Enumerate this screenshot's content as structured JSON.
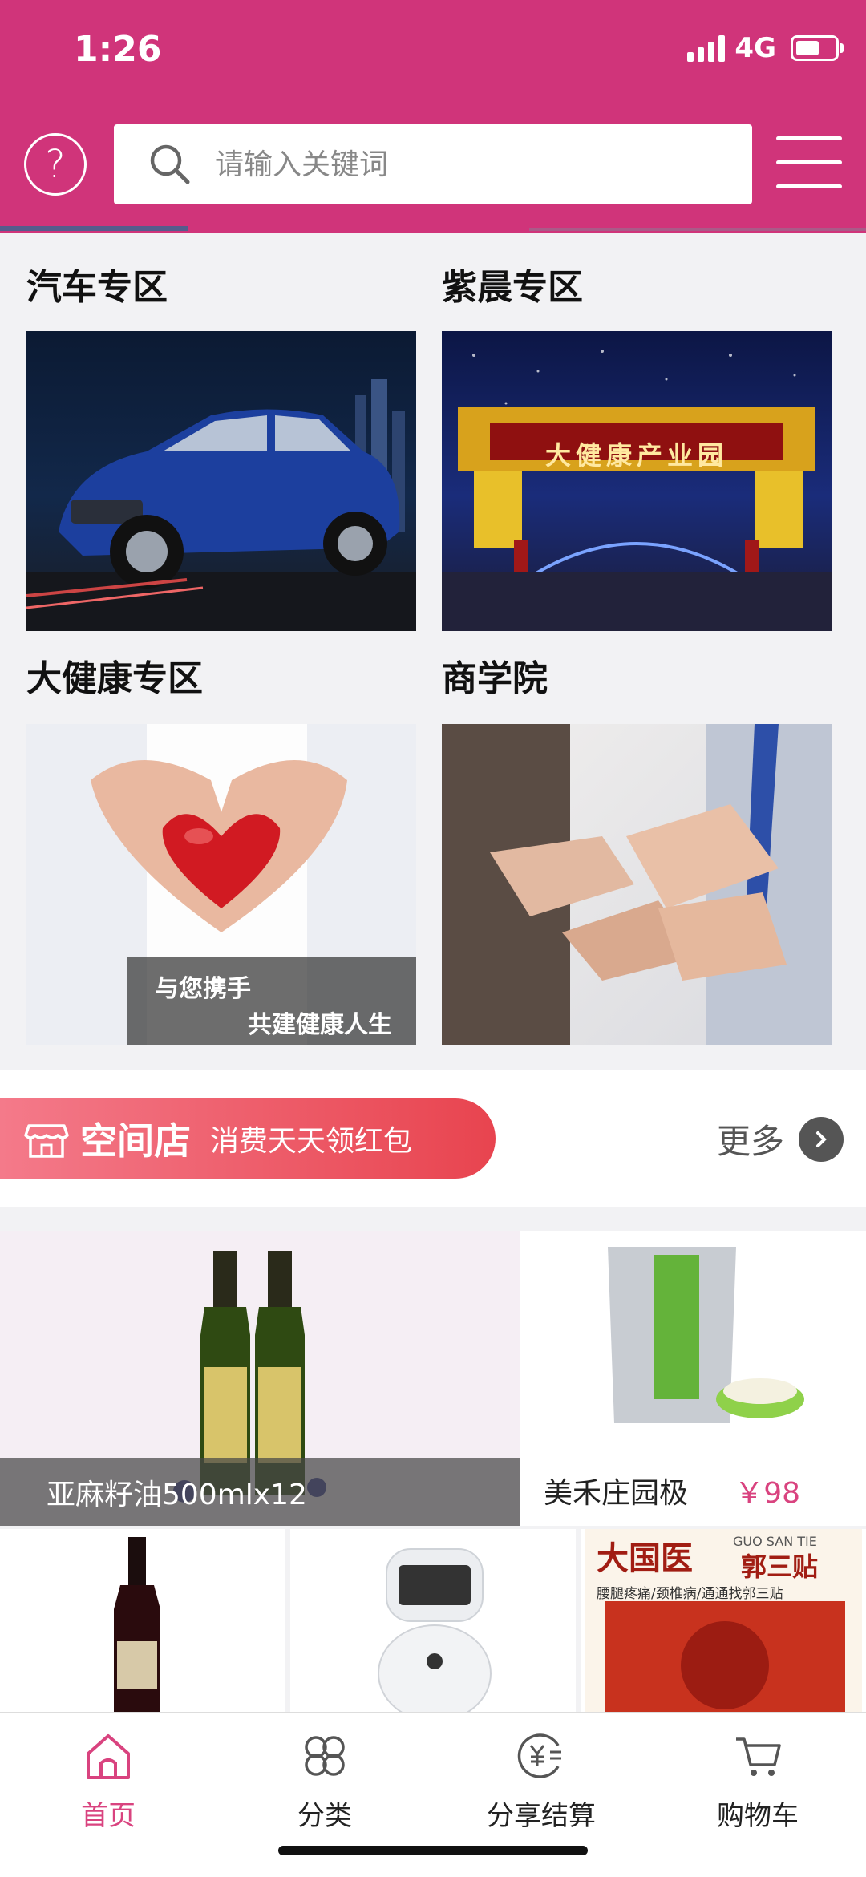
{
  "status_bar": {
    "time": "1:26",
    "network": "4G"
  },
  "search": {
    "placeholder": "请输入关键词"
  },
  "zones": [
    {
      "title": "汽车专区"
    },
    {
      "title": "紫晨专区"
    },
    {
      "title": "大健康专区"
    },
    {
      "title": "商学院"
    }
  ],
  "zone_images": {
    "park_sign": "大健康产业园",
    "health_line1": "与您携手",
    "health_line2": "共建健康人生"
  },
  "shop_banner": {
    "title": "空间店",
    "subtitle": "消费天天领红包",
    "more_label": "更多"
  },
  "products": {
    "featured": {
      "name": "亚麻籽油500mlx12"
    },
    "right": {
      "name": "美禾庄园极",
      "price": "￥98"
    },
    "small3_sign": "大国医",
    "small3_brand": "GUO SAN TIE",
    "small3_sub": "郭三贴",
    "small3_caption": "腰腿疼痛/颈椎病/通通找郭三贴"
  },
  "bottom_nav": [
    {
      "label": "首页"
    },
    {
      "label": "分类"
    },
    {
      "label": "分享结算"
    },
    {
      "label": "购物车"
    }
  ],
  "colors": {
    "brand": "#d0347a",
    "accent": "#d9437f",
    "shop_banner": "#e8444f"
  }
}
